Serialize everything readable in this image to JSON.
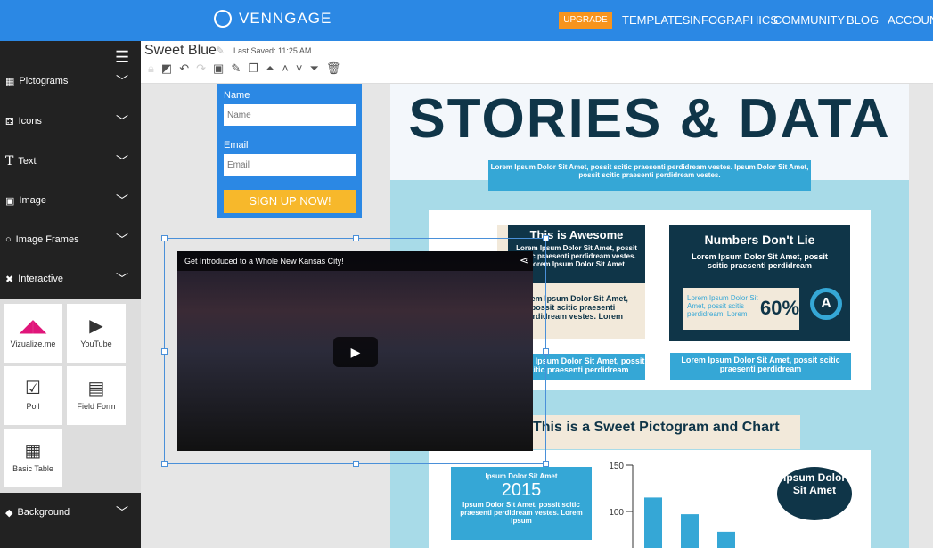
{
  "header": {
    "logo": "VENNGAGE",
    "upgrade": "UPGRADE",
    "nav": [
      "TEMPLATES",
      "INFOGRAPHICS",
      "COMMUNITY",
      "BLOG",
      "ACCOUNT"
    ]
  },
  "sidebar": {
    "items": [
      {
        "label": "Pictograms",
        "icon": "grid-icon"
      },
      {
        "label": "Icons",
        "icon": "dice-icon"
      },
      {
        "label": "Text",
        "icon": "text-icon"
      },
      {
        "label": "Image",
        "icon": "image-icon"
      },
      {
        "label": "Image Frames",
        "icon": "circle-icon"
      },
      {
        "label": "Interactive",
        "icon": "shuffle-icon"
      }
    ],
    "tiles": [
      {
        "label": "Vizualize.me"
      },
      {
        "label": "YouTube"
      },
      {
        "label": "Poll"
      },
      {
        "label": "Field Form"
      },
      {
        "label": "Basic Table"
      }
    ],
    "background": "Background"
  },
  "toolbar": {
    "doc_title": "Sweet Blue",
    "last_saved": "Last Saved: 11:25 AM"
  },
  "form": {
    "name_label": "Name",
    "name_placeholder": "Name",
    "email_label": "Email",
    "email_placeholder": "Email",
    "submit": "SIGN UP NOW!"
  },
  "video": {
    "title": "Get Introduced to a Whole New Kansas City!"
  },
  "infographic": {
    "title": "STORIES & DATA",
    "ribbon": "Lorem Ipsum Dolor Sit Amet, possit scitic praesenti perdidream vestes. Ipsum Dolor Sit Amet, possit scitic praesenti perdidream vestes.",
    "box1_title": "This is Awesome",
    "box1_text": "Lorem Ipsum Dolor Sit Amet, possit scitic praesenti perdidream vestes. Lorem Ipsum Dolor Sit Amet",
    "box1_cream": "Lorem Ipsum Dolor Sit Amet, possit scitic praesenti perdidream vestes. Lorem",
    "box1_blue": "Lorem Ipsum Dolor Sit Amet, possit scitic praesenti perdidream",
    "box2_title": "Numbers Don't Lie",
    "box2_text": "Lorem Ipsum Dolor Sit Amet, possit scitic praesenti perdidream",
    "box2_small": "Lorem Ipsum Dolor Sit Amet, possit scitis perdidream. Lorem",
    "box2_percent": "60%",
    "box2_blue": "Lorem Ipsum Dolor Sit Amet, possit scitic praesenti perdidream",
    "section_title": "This is a Sweet Pictogram and Chart",
    "callout_title": "Ipsum Dolor Sit Amet",
    "callout_year": "2015",
    "callout_text": "Ipsum Dolor Sit Amet, possit scitic praesenti perdidream vestes. Lorem Ipsum",
    "bubble": "Ipsum Dolor Sit Amet"
  },
  "chart_data": {
    "type": "bar",
    "values": [
      115,
      97,
      78
    ],
    "yticks": [
      100,
      150
    ],
    "ylim": [
      null,
      150
    ],
    "color": "#35a7d6"
  }
}
